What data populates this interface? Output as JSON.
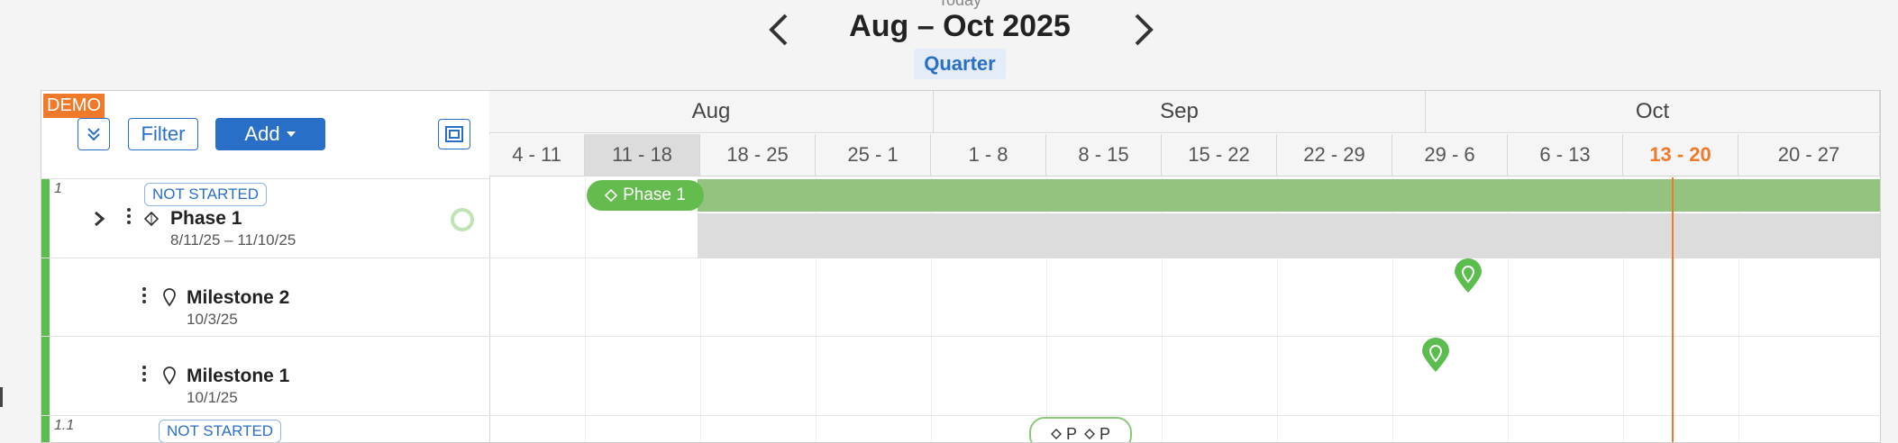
{
  "header": {
    "today_label": "Today",
    "period_title": "Aug – Oct 2025",
    "view_mode": "Quarter"
  },
  "toolbar": {
    "demo_badge": "DEMO",
    "filter_label": "Filter",
    "add_label": "Add"
  },
  "timeline": {
    "months": [
      "Aug",
      "Sep",
      "Oct"
    ],
    "weeks": [
      "4 - 11",
      "11 - 18",
      "18 - 25",
      "25 - 1",
      "1 - 8",
      "8 - 15",
      "15 - 22",
      "22 - 29",
      "29 - 6",
      "6 - 13",
      "13 - 20",
      "20 - 27"
    ],
    "highlight_week": "11 - 18",
    "today_week": "13 - 20"
  },
  "tasks": [
    {
      "num": "1",
      "status": "NOT STARTED",
      "name": "Phase 1",
      "dates": "8/11/25 – 11/10/25",
      "bar_label": "Phase 1"
    },
    {
      "num": "",
      "status": "",
      "name": "Milestone 2",
      "dates": "10/3/25"
    },
    {
      "num": "",
      "status": "",
      "name": "Milestone 1",
      "dates": "10/1/25"
    },
    {
      "num": "1.1",
      "status": "NOT STARTED",
      "name": "",
      "dates": "",
      "chip_a": "P",
      "chip_b": "P"
    }
  ],
  "colors": {
    "accent": "#2a6fc7",
    "green": "#63bc4d",
    "orange": "#f07a2a"
  }
}
